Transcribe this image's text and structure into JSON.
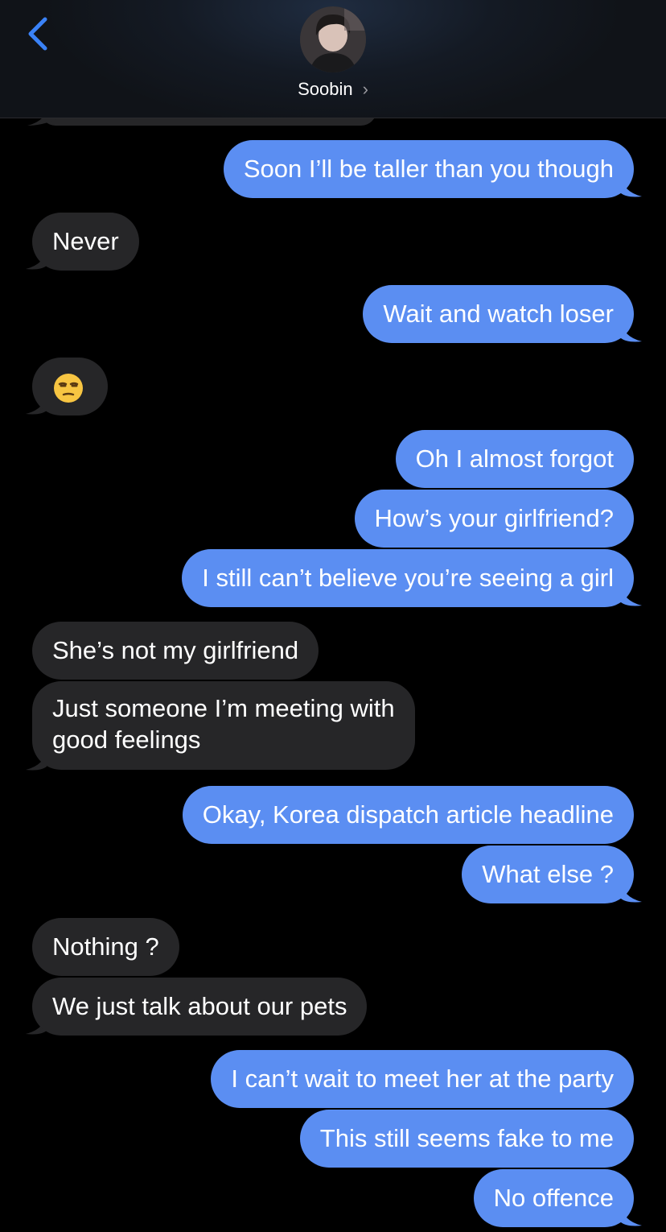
{
  "header": {
    "contact_name": "Soobin",
    "chevron": "›",
    "back_icon": "chevron-left-icon"
  },
  "colors": {
    "sent": "#5b8ef2",
    "received": "#262628",
    "accent": "#3a82f7",
    "background": "#000000"
  },
  "messages": [
    {
      "from": "me",
      "text": "Soon I’ll be taller than you though"
    },
    {
      "from": "them",
      "text": "Never"
    },
    {
      "from": "me",
      "text": "Wait and watch loser"
    },
    {
      "from": "them",
      "text": "",
      "emoji": "unamused-face-emoji"
    },
    {
      "from": "me",
      "text": "Oh I almost forgot"
    },
    {
      "from": "me",
      "text": "How’s your girlfriend?"
    },
    {
      "from": "me",
      "text": "I still can’t believe you’re seeing a girl"
    },
    {
      "from": "them",
      "text": "She’s not my girlfriend"
    },
    {
      "from": "them",
      "text": "Just someone I’m meeting with",
      "text2": "good feelings"
    },
    {
      "from": "me",
      "text": "Okay, Korea dispatch article headline"
    },
    {
      "from": "me",
      "text": "What else ?"
    },
    {
      "from": "them",
      "text": "Nothing ?"
    },
    {
      "from": "them",
      "text": "We just talk about our pets"
    },
    {
      "from": "me",
      "text": "I can’t wait to meet her at the party"
    },
    {
      "from": "me",
      "text": "This still seems fake to me"
    },
    {
      "from": "me",
      "text": "No offence"
    }
  ]
}
